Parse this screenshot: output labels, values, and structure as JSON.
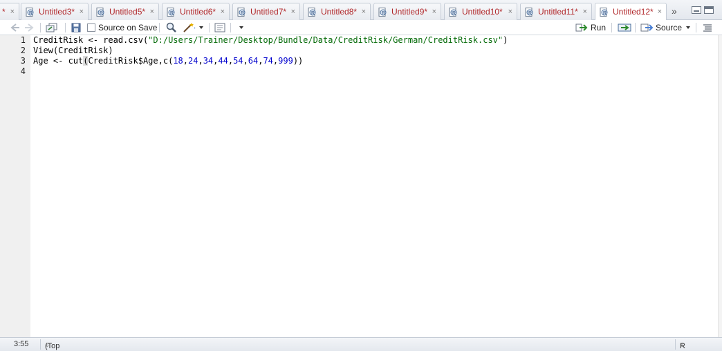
{
  "tabs": {
    "partial_label": "*",
    "items": [
      {
        "label": "Untitled3*"
      },
      {
        "label": "Untitled5*"
      },
      {
        "label": "Untitled6*"
      },
      {
        "label": "Untitled7*"
      },
      {
        "label": "Untitled8*"
      },
      {
        "label": "Untitled9*"
      },
      {
        "label": "Untitled10*"
      },
      {
        "label": "Untitled11*"
      },
      {
        "label": "Untitled12*"
      }
    ],
    "close_glyph": "×",
    "overflow_glyph": "»"
  },
  "toolbar": {
    "source_on_save": "Source on Save",
    "run": "Run",
    "source": "Source"
  },
  "editor": {
    "line_numbers": [
      "1",
      "2",
      "3",
      "4"
    ],
    "lines": {
      "l1_a": "CreditRisk <- read.csv(",
      "l1_str": "\"D:/Users/Trainer/Desktop/Bundle/Data/CreditRisk/German/CreditRisk.csv\"",
      "l1_b": ")",
      "l2_a": "View(CreditRisk",
      "l2_b": ")",
      "l3_a": "Age <- cut",
      "l3_brk": "(",
      "l3_b": "CreditRisk$Age,c(",
      "l3_nums": [
        "18",
        "24",
        "34",
        "44",
        "54",
        "64",
        "74",
        "999"
      ],
      "l3_c": "))"
    }
  },
  "status": {
    "position": "3:55",
    "scope": "(Top Level)",
    "file_type": "R Script"
  },
  "colors": {
    "tab_text": "#b1282b",
    "string": "#036a07",
    "number": "#0000cd"
  }
}
